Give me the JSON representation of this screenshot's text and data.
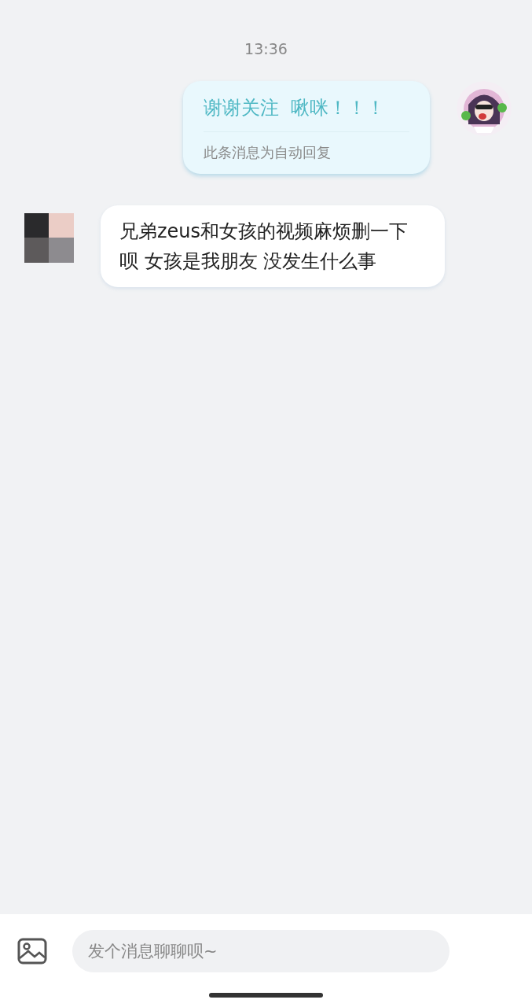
{
  "time_divider": "13:36",
  "messages": [
    {
      "kind": "auto_reply",
      "text": "谢谢关注  啾咪！！！",
      "note": "此条消息为自动回复"
    },
    {
      "kind": "text",
      "text": "兄弟zeus和女孩的视频麻烦删一下呗 女孩是我朋友 没发生什么事"
    }
  ],
  "composer": {
    "placeholder": "发个消息聊聊呗~"
  }
}
